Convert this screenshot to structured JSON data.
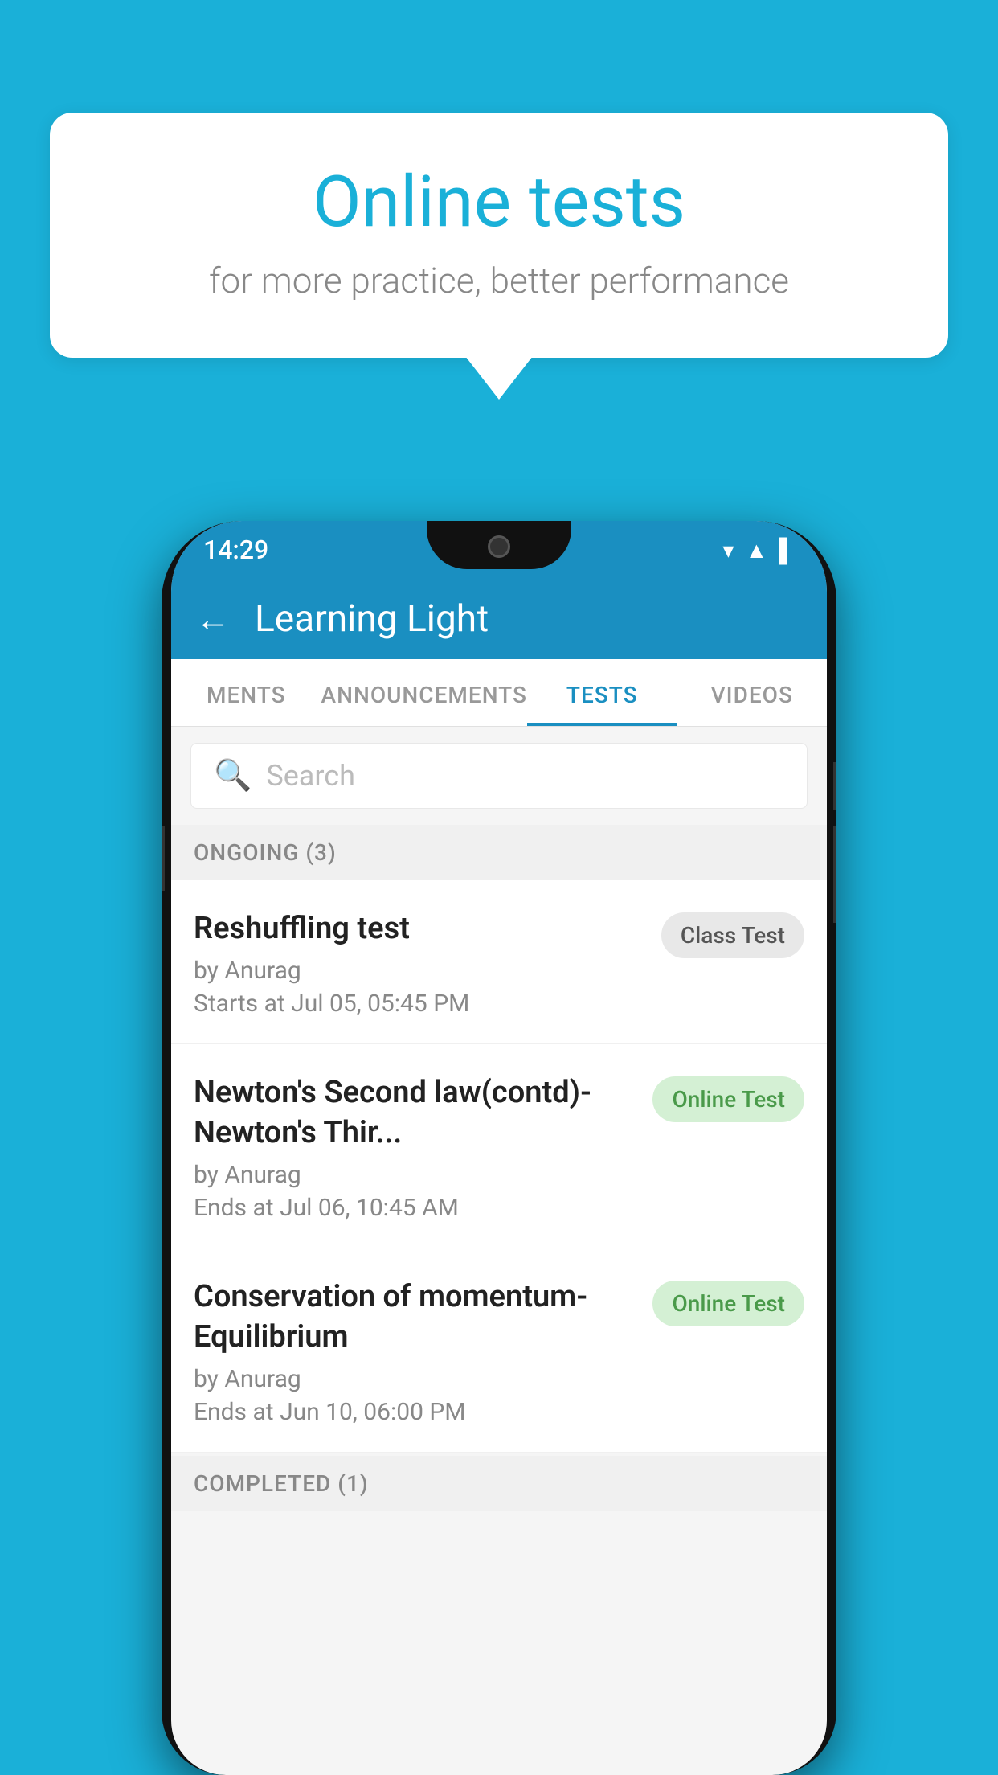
{
  "background_color": "#1ab0d8",
  "speech_bubble": {
    "title": "Online tests",
    "subtitle": "for more practice, better performance"
  },
  "status_bar": {
    "time": "14:29",
    "icons": [
      "▼",
      "▲",
      "▌"
    ]
  },
  "app_header": {
    "back_label": "←",
    "title": "Learning Light"
  },
  "tabs": [
    {
      "label": "MENTS",
      "active": false
    },
    {
      "label": "ANNOUNCEMENTS",
      "active": false
    },
    {
      "label": "TESTS",
      "active": true
    },
    {
      "label": "VIDEOS",
      "active": false
    }
  ],
  "search": {
    "placeholder": "Search"
  },
  "ongoing_section": {
    "label": "ONGOING (3)"
  },
  "tests": [
    {
      "title": "Reshuffling test",
      "author": "by Anurag",
      "time_label": "Starts at",
      "time": "Jul 05, 05:45 PM",
      "badge": "Class Test",
      "badge_type": "class"
    },
    {
      "title": "Newton's Second law(contd)-Newton's Thir...",
      "author": "by Anurag",
      "time_label": "Ends at",
      "time": "Jul 06, 10:45 AM",
      "badge": "Online Test",
      "badge_type": "online"
    },
    {
      "title": "Conservation of momentum-Equilibrium",
      "author": "by Anurag",
      "time_label": "Ends at",
      "time": "Jun 10, 06:00 PM",
      "badge": "Online Test",
      "badge_type": "online"
    }
  ],
  "completed_section": {
    "label": "COMPLETED (1)"
  }
}
